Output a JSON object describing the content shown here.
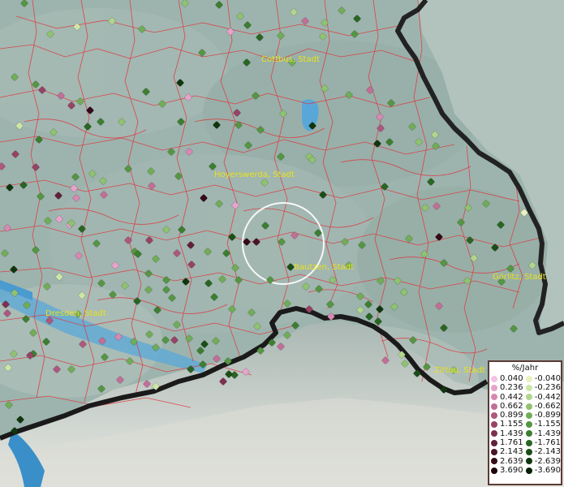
{
  "map": {
    "cities": [
      {
        "name": "Cottbus, Stadt"
      },
      {
        "name": "Hoyerswerda, Stadt"
      },
      {
        "name": "Bautzen, Stadt"
      },
      {
        "name": "Görlitz, Stadt"
      },
      {
        "name": "Dresden, Stadt"
      },
      {
        "name": "Zittau, Stadt"
      }
    ]
  },
  "legend": {
    "title": "%/Jahr",
    "positive": [
      {
        "label": "0.040",
        "color": "#f4c2e4"
      },
      {
        "label": "0.236",
        "color": "#e6a3cc"
      },
      {
        "label": "0.442",
        "color": "#d689b2"
      },
      {
        "label": "0.662",
        "color": "#c26f97"
      },
      {
        "label": "0.899",
        "color": "#ad587d"
      },
      {
        "label": "1.155",
        "color": "#964365"
      },
      {
        "label": "1.439",
        "color": "#7d3050"
      },
      {
        "label": "1.761",
        "color": "#63203b"
      },
      {
        "label": "2.143",
        "color": "#4a1428"
      },
      {
        "label": "2.639",
        "color": "#330a18"
      },
      {
        "label": "3.690",
        "color": "#1e040c"
      }
    ],
    "negative": [
      {
        "label": "-0.040",
        "color": "#e8f2bf"
      },
      {
        "label": "-0.236",
        "color": "#cde6a8"
      },
      {
        "label": "-0.442",
        "color": "#afd68d"
      },
      {
        "label": "-0.662",
        "color": "#8fc271"
      },
      {
        "label": "-0.899",
        "color": "#71ac58"
      },
      {
        "label": "-1.155",
        "color": "#559643"
      },
      {
        "label": "-1.439",
        "color": "#3d7e31"
      },
      {
        "label": "-1.761",
        "color": "#2a6623"
      },
      {
        "label": "-2.143",
        "color": "#1b4e17"
      },
      {
        "label": "-2.639",
        "color": "#10360e"
      },
      {
        "label": "-3.690",
        "color": "#062006"
      }
    ]
  }
}
